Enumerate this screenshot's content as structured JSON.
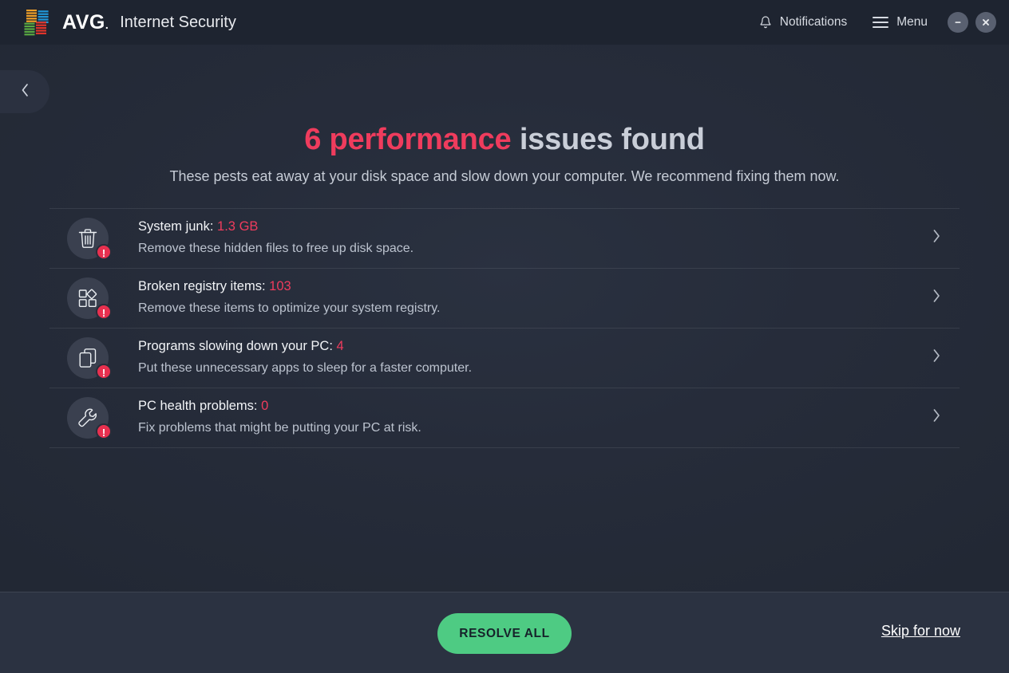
{
  "window": {
    "brand_mark": "AVG",
    "brand_dot": ".",
    "product": "Internet Security",
    "logo_icon": "avg-pinwheel-logo",
    "notifications_label": "Notifications",
    "notifications_icon": "bell-icon",
    "menu_label": "Menu",
    "menu_icon": "hamburger-icon",
    "minimize_icon": "minimize-icon",
    "close_icon": "close-icon",
    "back_icon": "chevron-left-icon"
  },
  "header": {
    "title_highlight": "6 performance",
    "title_rest": " issues found",
    "subtitle": "These pests eat away at your disk space and slow down your computer. We recommend fixing them now."
  },
  "issues": [
    {
      "icon": "trash-can-icon",
      "badge": "!",
      "title_label": "System junk: ",
      "count": "1.3 GB",
      "description": "Remove these hidden files to free up disk space.",
      "chevron": "chevron-right-icon"
    },
    {
      "icon": "registry-blocks-icon",
      "badge": "!",
      "title_label": "Broken registry items: ",
      "count": "103",
      "description": "Remove these items to optimize your system registry.",
      "chevron": "chevron-right-icon"
    },
    {
      "icon": "windows-stack-icon",
      "badge": "!",
      "title_label": "Programs slowing down your PC: ",
      "count": "4",
      "description": "Put these unnecessary apps to sleep for a faster computer.",
      "chevron": "chevron-right-icon"
    },
    {
      "icon": "wrench-icon",
      "badge": "!",
      "title_label": "PC health problems: ",
      "count": "0",
      "description": "Fix problems that might be putting your PC at risk.",
      "chevron": "chevron-right-icon"
    }
  ],
  "footer": {
    "resolve_label": "RESOLVE ALL",
    "skip_label": "Skip for now"
  },
  "colors": {
    "accent_red": "#ef3c5d",
    "accent_green": "#4ecb83",
    "badge_red": "#e8304f",
    "window_bg": "#222834",
    "footer_bg": "#2b3241",
    "logo_orange": "#f0a028",
    "logo_blue": "#2196d6",
    "logo_green": "#59a942",
    "logo_red": "#e0342a"
  }
}
